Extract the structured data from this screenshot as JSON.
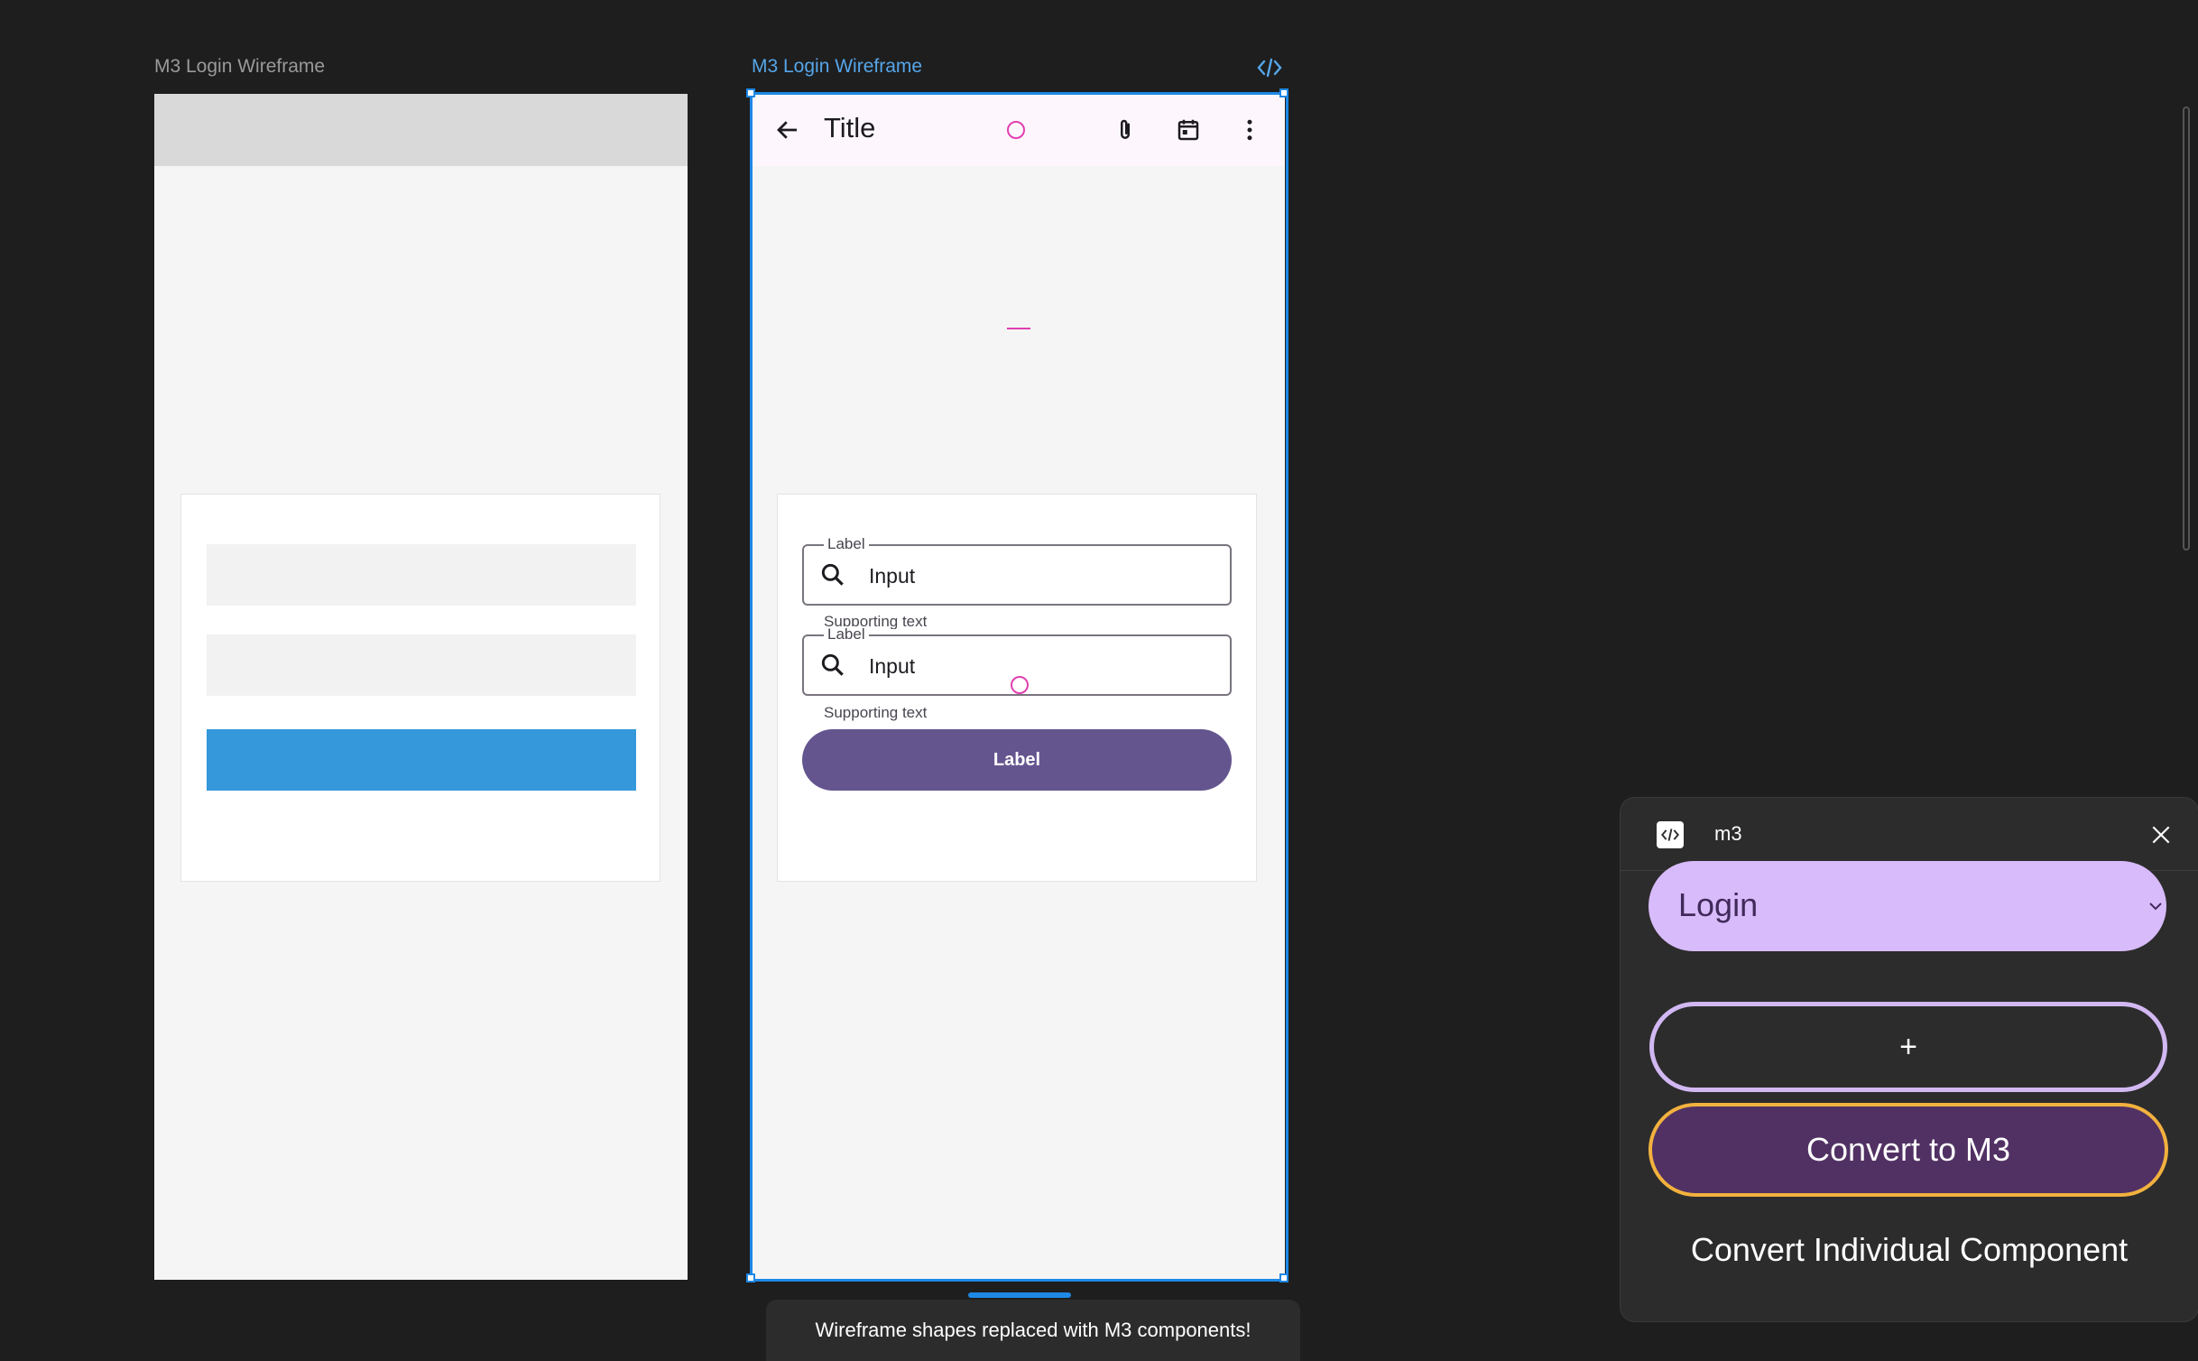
{
  "canvas": {
    "left_frame_name": "M3 Login Wireframe",
    "right_frame_name": "M3 Login Wireframe",
    "code_icon": "code-icon"
  },
  "m3": {
    "appbar": {
      "title": "Title",
      "icons": [
        "arrow-back-icon",
        "attach-icon",
        "calendar-icon",
        "more-vert-icon"
      ]
    },
    "fields": [
      {
        "label": "Label",
        "value": "Input",
        "supporting": "Supporting text"
      },
      {
        "label": "Label",
        "value": "Input",
        "supporting": "Supporting text"
      }
    ],
    "button_label": "Label"
  },
  "toast": "Wireframe shapes replaced with M3 components!",
  "panel": {
    "name": "m3",
    "select_value": "Login",
    "add_label": "+",
    "convert_label": "Convert to M3",
    "individual_label": "Convert Individual Component"
  },
  "colors": {
    "selection": "#1e88e5",
    "primary": "#65558f",
    "select_bg": "#d8bbfb",
    "convert_bg": "#513163",
    "convert_border": "#f2b13e",
    "wire_button": "#3498db"
  }
}
